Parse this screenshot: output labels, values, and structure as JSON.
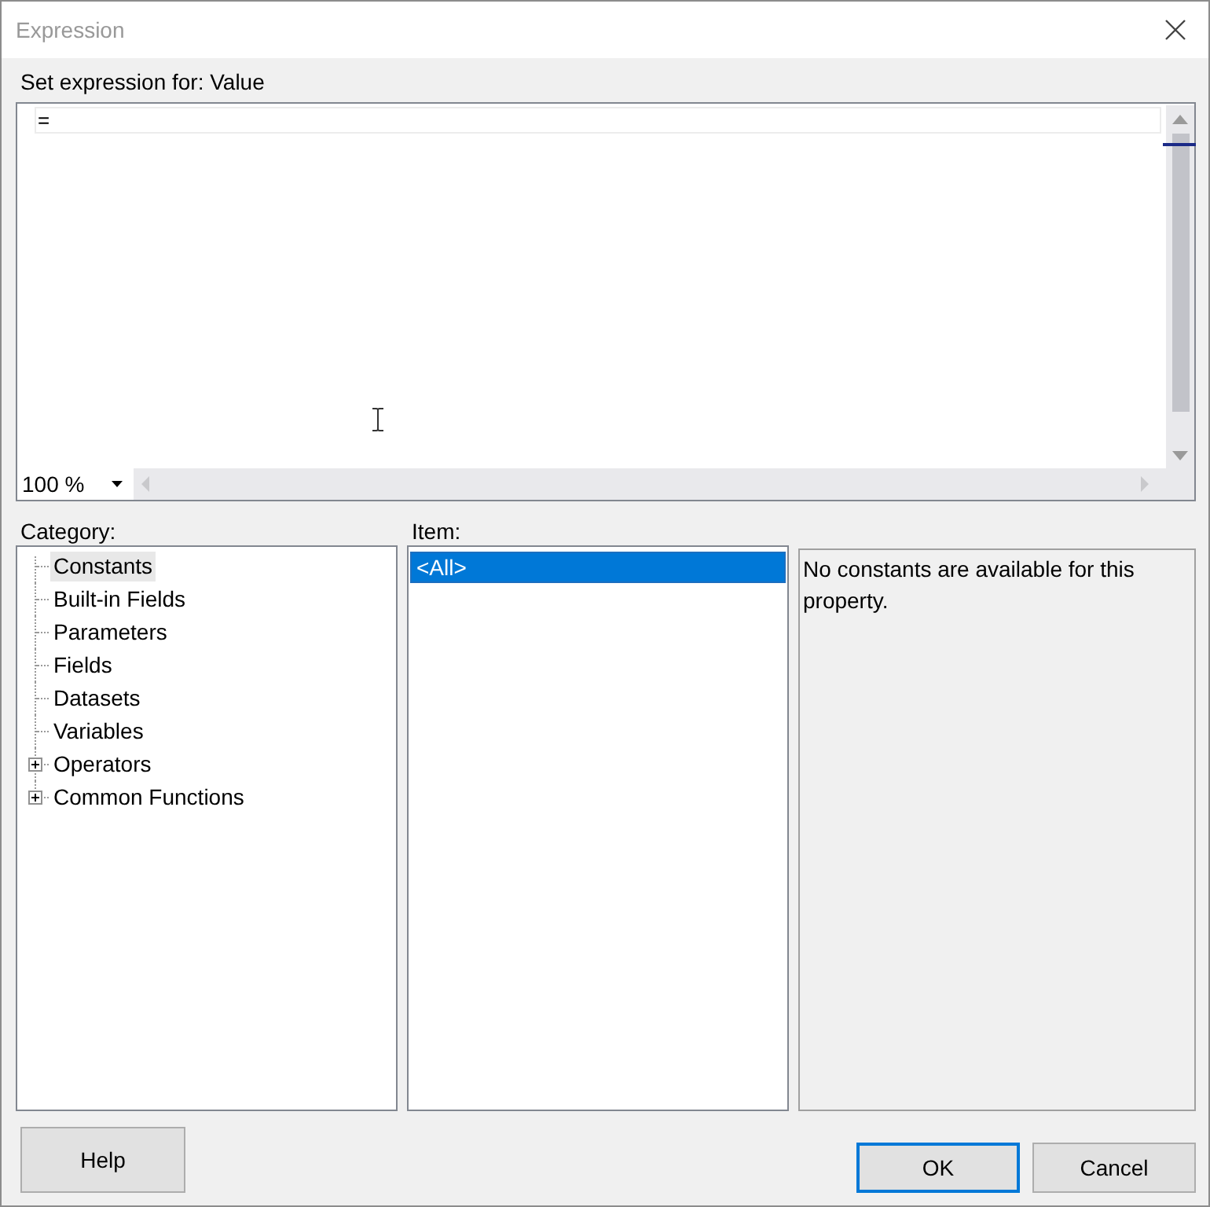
{
  "window": {
    "title": "Expression"
  },
  "expression": {
    "label": "Set expression for: Value",
    "lines": [
      "="
    ],
    "zoom": "100 %"
  },
  "category": {
    "label": "Category:",
    "items": [
      {
        "label": "Constants",
        "kind": "leaf",
        "selected": true
      },
      {
        "label": "Built-in Fields",
        "kind": "leaf",
        "selected": false
      },
      {
        "label": "Parameters",
        "kind": "leaf",
        "selected": false
      },
      {
        "label": "Fields",
        "kind": "leaf",
        "selected": false
      },
      {
        "label": "Datasets",
        "kind": "leaf",
        "selected": false
      },
      {
        "label": "Variables",
        "kind": "leaf",
        "selected": false
      },
      {
        "label": "Operators",
        "kind": "group",
        "expanded": false,
        "selected": false
      },
      {
        "label": "Common Functions",
        "kind": "group",
        "expanded": false,
        "selected": false
      }
    ]
  },
  "item": {
    "label": "Item:",
    "items": [
      {
        "label": "<All>",
        "selected": true
      }
    ]
  },
  "description": "No constants are available for this property.",
  "help_button": {
    "label": "Help"
  },
  "buttons": [
    {
      "label": "OK",
      "default": true
    },
    {
      "label": "Cancel",
      "default": false
    }
  ]
}
